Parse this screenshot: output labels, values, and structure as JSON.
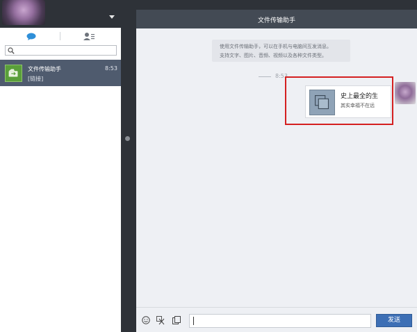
{
  "sidebar": {
    "search": {
      "placeholder": "",
      "value": ""
    },
    "chat_list": [
      {
        "title": "文件传输助手",
        "time": "8:53",
        "preview": "[链接]"
      }
    ]
  },
  "conversation": {
    "title": "文件传输助手",
    "info_line1": "使用文件传输助手，可以在手机与电脑间互发消息。",
    "info_line2": "支持文字、图片、音频、视频以及各种文件类型。",
    "time_divider": "8:53",
    "message": {
      "title": "史上最全的生",
      "subtitle": "其实幸福不在远"
    }
  },
  "composer": {
    "input_value": "",
    "send_label": "发送"
  },
  "icons": {
    "chat_tab": "speech-bubble-icon",
    "contacts_tab": "contacts-icon",
    "search": "search-icon",
    "emoji": "smiley-icon",
    "screenshot": "scissors-icon",
    "file": "file-icon"
  },
  "colors": {
    "dark_bg": "#2e3238",
    "selected_item": "#4f5b6e",
    "send_button": "#3d6fb5",
    "highlight": "#d41f1f",
    "title_bar": "#434a54"
  }
}
